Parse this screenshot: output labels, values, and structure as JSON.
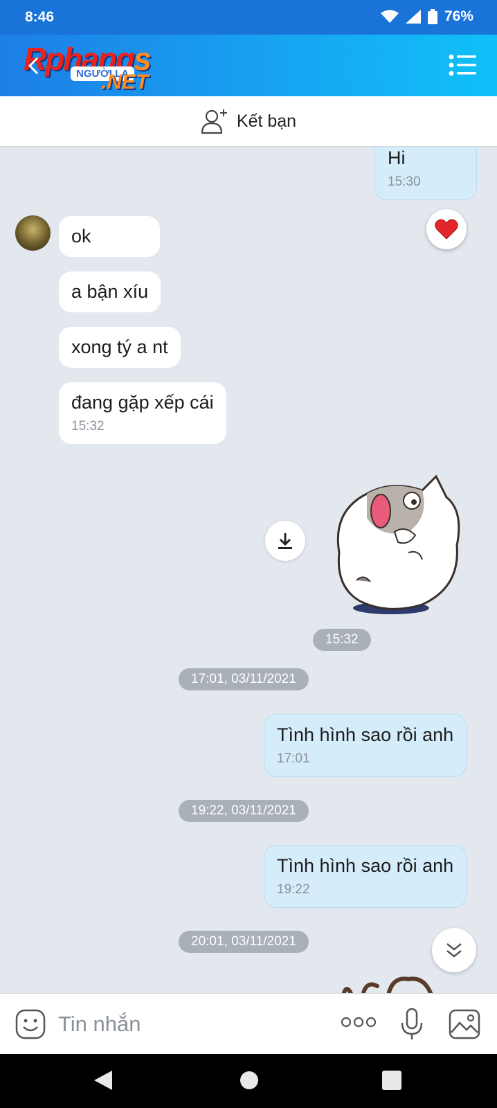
{
  "status_bar": {
    "time": "8:46",
    "battery": "76%",
    "icons": [
      "wifi-icon",
      "signal-icon",
      "battery-icon"
    ]
  },
  "header": {
    "logo_text": "Rphangs",
    "logo_pill": "NGƯỜI LA",
    "logo_net": ".NET",
    "icons": [
      "back-icon",
      "menu-icon"
    ],
    "colors": {
      "gradient_start": "#1c7fe6",
      "gradient_end": "#0fc0f7"
    }
  },
  "friend_bar": {
    "label": "Kết bạn",
    "icon": "add-friend-icon"
  },
  "messages": {
    "out_hi": {
      "text": "Hi",
      "time": "15:30"
    },
    "in_1": {
      "text": "ok"
    },
    "in_2": {
      "text": "a bận xíu"
    },
    "in_3": {
      "text": "xong tý a nt"
    },
    "in_4": {
      "text": "đang gặp xếp cái",
      "time": "15:32"
    },
    "sticker_time": "15:32",
    "divider_1": "17:01, 03/11/2021",
    "out_2": {
      "text": "Tình hình sao rồi anh",
      "time": "17:01"
    },
    "divider_2": "19:22, 03/11/2021",
    "out_3": {
      "text": "Tình hình sao rồi anh",
      "time": "19:22"
    },
    "divider_3": "20:01, 03/11/2021",
    "reaction": "heart-icon"
  },
  "input_bar": {
    "placeholder": "Tin nhắn",
    "icons": [
      "emoji-icon",
      "more-icon",
      "microphone-icon",
      "image-icon"
    ]
  },
  "nav_bar": {
    "icons": [
      "nav-back-icon",
      "nav-home-icon",
      "nav-recents-icon"
    ]
  }
}
